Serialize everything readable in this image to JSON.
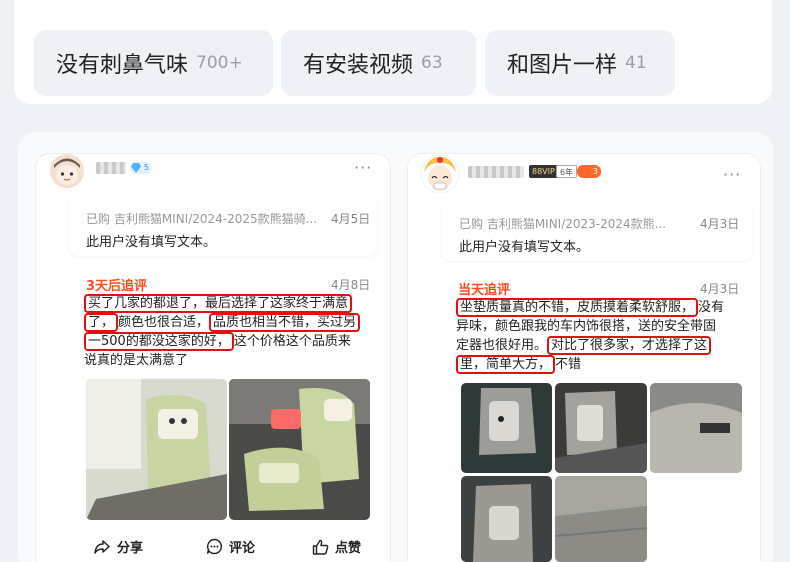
{
  "tags": [
    {
      "text": "没有刺鼻气味",
      "count": "700+"
    },
    {
      "text": "有安装视频",
      "count": "63"
    },
    {
      "text": "和图片一样",
      "count": "41"
    }
  ],
  "reviews": [
    {
      "gem_level": "5",
      "purchase": "已购 吉利熊猫MINI/2024-2025款熊猫骑...",
      "date": "4月5日",
      "text": "此用户没有填写文本。",
      "follow_title": "3天后追评",
      "follow_date": "4月8日",
      "follow_lines": [
        [
          {
            "t": "买了几家的都退了，最后选择了这家终于满意",
            "hl": true
          }
        ],
        [
          {
            "t": "了，",
            "hl": true
          },
          {
            "t": "颜色也很合适，",
            "hl": false
          },
          {
            "t": "品质也相当不错，买过另",
            "hl": true
          }
        ],
        [
          {
            "t": "一500的都没这家的好，",
            "hl": true
          },
          {
            "t": "这个价格这个品质来",
            "hl": false
          }
        ],
        [
          {
            "t": "说真的是太满意了",
            "hl": false
          }
        ]
      ]
    },
    {
      "vip": "88VIP",
      "years": "6年",
      "level": "3",
      "purchase": "已购 吉利熊猫MINI/2023-2024款熊...",
      "date": "4月3日",
      "text": "此用户没有填写文本。",
      "follow_title": "当天追评",
      "follow_date": "4月3日",
      "follow_lines": [
        [
          {
            "t": "坐垫质量真的不错，皮质摸着柔软舒服，",
            "hl": true
          },
          {
            "t": "没有",
            "hl": false
          }
        ],
        [
          {
            "t": "异味，颜色跟我的车内饰很搭，送的安全带固",
            "hl": false
          }
        ],
        [
          {
            "t": "定器也很好用。",
            "hl": false
          },
          {
            "t": "对比了很多家，才选择了这",
            "hl": true
          }
        ],
        [
          {
            "t": "里，简单大方，",
            "hl": true
          },
          {
            "t": "不错",
            "hl": false
          }
        ]
      ]
    }
  ],
  "actions": {
    "share": "分享",
    "comment": "评论",
    "like": "点赞"
  },
  "colors": {
    "follow_title": "#ff4b1f",
    "highlight_border": "#e01111",
    "seat_green": "#c9d6a2",
    "seat_grey": "#8f8f8f"
  }
}
